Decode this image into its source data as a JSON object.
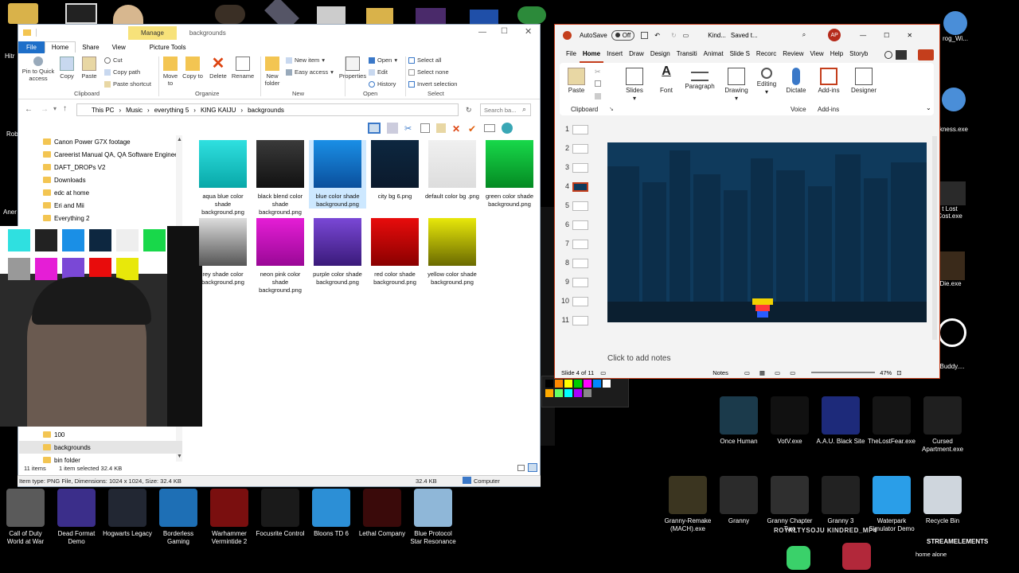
{
  "desktop": {
    "left_icons": [
      {
        "label": "Call of Duty World at War",
        "color": "#5a5a5a"
      },
      {
        "label": "Dead Format Demo",
        "color": "#3b2e8a"
      },
      {
        "label": "Hogwarts Legacy",
        "color": "#222733"
      },
      {
        "label": "Borderless Gaming",
        "color": "#1e6fb5"
      },
      {
        "label": "Warhammer Vermintide 2",
        "color": "#7a0f0f"
      },
      {
        "label": "Focusrite Control",
        "color": "#1a1a1a"
      },
      {
        "label": "Bloons TD 6",
        "color": "#2c8fd6"
      },
      {
        "label": "Lethal Company",
        "color": "#3a0a0a"
      },
      {
        "label": "Blue Protocol Star Resonance",
        "color": "#8fb7d8"
      }
    ],
    "right_icons_row1": [
      {
        "label": "Once Human",
        "color": "#1b3a4b"
      },
      {
        "label": "VotV.exe",
        "color": "#111111"
      },
      {
        "label": "A.A.U. Black Site",
        "color": "#1d2a7a"
      },
      {
        "label": "TheLostFear.exe",
        "color": "#151515"
      },
      {
        "label": "Cursed Apartment.exe",
        "color": "#1f1f1f"
      }
    ],
    "right_icons_row2": [
      {
        "label": "Granny-Remake (MACH).exe",
        "color": "#3b3520"
      },
      {
        "label": "Granny",
        "color": "#2b2b2b"
      },
      {
        "label": "Granny Chapter Two",
        "color": "#2f2f2f"
      },
      {
        "label": "Granny 3",
        "color": "#222222"
      },
      {
        "label": "Waterpark Simulator Demo",
        "color": "#2a9ee8"
      },
      {
        "label": "Recycle Bin",
        "color": "#cfd6dd"
      }
    ],
    "side_labels": {
      "lost_cost": "t Lost Cost.exe",
      "buddy": "Buddy....",
      "die": "Die.exe",
      "ness": "kness.exe",
      "frog": "rog_Wi..."
    },
    "overlay_text": {
      "kindred": "ROYALTYSOJU KINDRED_MP4",
      "stream": "STREAMELEMENTS",
      "home_alone": "home alone"
    }
  },
  "explorer": {
    "title": "backgrounds",
    "manage_tab": "Manage",
    "tabs": [
      "File",
      "Home",
      "Share",
      "View",
      "Picture Tools"
    ],
    "clipboard": {
      "pin": "Pin to Quick access",
      "copy": "Copy",
      "paste": "Paste",
      "cut": "Cut",
      "copy_path": "Copy path",
      "paste_shortcut": "Paste shortcut",
      "group": "Clipboard"
    },
    "organize": {
      "move": "Move to",
      "copy": "Copy to",
      "delete": "Delete",
      "rename": "Rename",
      "group": "Organize"
    },
    "new": {
      "folder": "New folder",
      "new_item": "New item",
      "easy_access": "Easy access",
      "group": "New"
    },
    "open": {
      "properties": "Properties",
      "open": "Open",
      "edit": "Edit",
      "history": "History",
      "group": "Open"
    },
    "select": {
      "all": "Select all",
      "none": "Select none",
      "invert": "Invert selection",
      "group": "Select"
    },
    "breadcrumb": [
      "This PC",
      "Music",
      "everything 5",
      "KING KAIJU",
      "backgrounds"
    ],
    "search_placeholder": "Search ba...",
    "nav_items": [
      "Canon Power G7X footage",
      "Careerist Manual QA, QA Software Engineer",
      "DAFT_DROPs V2",
      "Downloads",
      "edc at home",
      "Eri and Mii",
      "Everything 2"
    ],
    "nav_items_bottom": [
      "100",
      "backgrounds",
      "bin folder"
    ],
    "files": [
      {
        "name": "aqua blue color shade background.png",
        "top": "#2fe0e0",
        "bottom": "#08a8a8"
      },
      {
        "name": "black blend color shade background.png",
        "top": "#3a3a3a",
        "bottom": "#111111"
      },
      {
        "name": "blue color shade background.png",
        "top": "#1a8fe6",
        "bottom": "#0a4f9c"
      },
      {
        "name": "city bg 6.png",
        "top": "#0d2740",
        "bottom": "#0b1a2c"
      },
      {
        "name": "default color bg .png",
        "top": "#f0f0f0",
        "bottom": "#dddddd"
      },
      {
        "name": "green color shade background.png",
        "top": "#18d84a",
        "bottom": "#048a22"
      },
      {
        "name": "grey shade color background.png",
        "top": "#dddddd",
        "bottom": "#555555"
      },
      {
        "name": "neon pink color shade background.png",
        "top": "#e51ed6",
        "bottom": "#9a0896"
      },
      {
        "name": "purple color shade background.png",
        "top": "#7a48d6",
        "bottom": "#3a1a7a"
      },
      {
        "name": "red color shade background.png",
        "top": "#e80c0c",
        "bottom": "#8a0000"
      },
      {
        "name": "yellow color shade background.png",
        "top": "#e8e80a",
        "bottom": "#6a6a00"
      }
    ],
    "files_display": [
      "aqua blue color shade background.png",
      "black blend color shade background.png",
      "blue color shade background.png",
      "city bg 6.png",
      "default color bg .png",
      "green color shade background.png",
      "rey shade color background.png",
      "neon pink color shade background.png",
      "purple color shade background.png",
      "red color shade background.png",
      "yellow color shade background.png"
    ],
    "status": {
      "count": "11 items",
      "selected": "1 item selected 32.4 KB",
      "item_type": "Item type: PNG File, Dimensions: 1024 x 1024, Size: 32.4 KB",
      "size": "32.4 KB",
      "location": "Computer"
    }
  },
  "ppt": {
    "autosave": "AutoSave",
    "autosave_state": "Off",
    "doc_title": "Kind...",
    "saved": "Saved t...",
    "avatar": "AP",
    "tabs": [
      "File",
      "Home",
      "Insert",
      "Draw",
      "Design",
      "Transiti",
      "Animat",
      "Slide S",
      "Recorc",
      "Review",
      "View",
      "Help",
      "Storyb"
    ],
    "ribbon": {
      "paste": "Paste",
      "clipboard": "Clipboard",
      "slides": "Slides",
      "font": "Font",
      "paragraph": "Paragraph",
      "drawing": "Drawing",
      "editing": "Editing",
      "dictate": "Dictate",
      "voice": "Voice",
      "addins": "Add-ins",
      "designer": "Designer",
      "addins_group": "Add-ins"
    },
    "slide_numbers": [
      "1",
      "2",
      "3",
      "4",
      "5",
      "6",
      "7",
      "8",
      "9",
      "10",
      "11"
    ],
    "current_slide": "4",
    "notes_placeholder": "Click to add notes",
    "status": {
      "slide": "Slide 4 of 11",
      "notes": "Notes",
      "zoom": "47%"
    },
    "slide_colors": {
      "sky": "#0f3a5c",
      "buildings": "#0c2e4a",
      "ground": "#0b1f30"
    }
  },
  "webcam": {
    "desc_label": ""
  }
}
